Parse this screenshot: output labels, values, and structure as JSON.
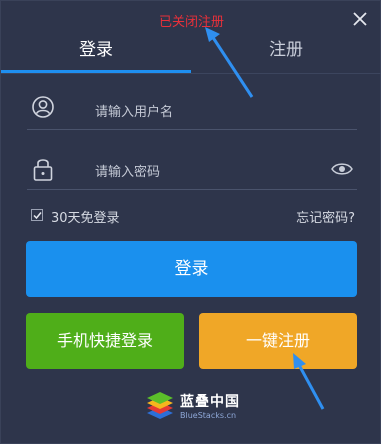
{
  "status_message": "已关闭注册",
  "tabs": [
    {
      "label": "登录",
      "active": true
    },
    {
      "label": "注册",
      "active": false
    }
  ],
  "form": {
    "username_placeholder": "请输入用户名",
    "password_placeholder": "请输入密码",
    "remember_label": "30天免登录",
    "remember_checked": true,
    "forgot_label": "忘记密码?"
  },
  "buttons": {
    "login": "登录",
    "phone_login": "手机快捷登录",
    "one_click_register": "一键注册"
  },
  "brand": {
    "name": "蓝叠中国",
    "domain": "BlueStacks.cn"
  },
  "colors": {
    "status_red": "#e8303a",
    "accent_blue": "#1a90ee",
    "phone_green": "#4fae19",
    "register_orange": "#f0a727",
    "annotation_arrow": "#2f8ff0"
  },
  "icons": {
    "close": "close-icon",
    "user": "user-icon",
    "lock": "lock-icon",
    "eye": "eye-icon",
    "check": "check-icon"
  }
}
